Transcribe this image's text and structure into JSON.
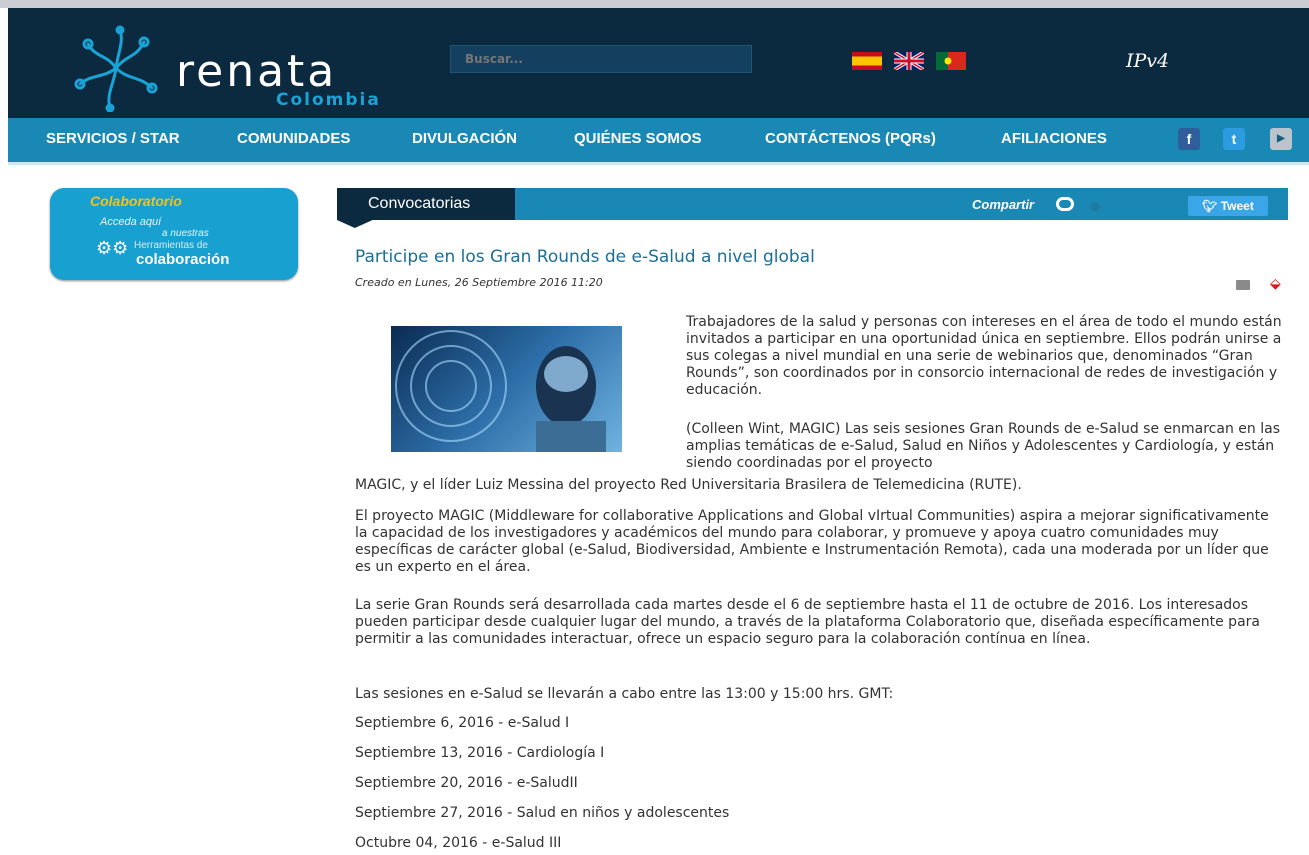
{
  "header": {
    "logo_text": "renata",
    "logo_sub": "Colombia",
    "search_placeholder": "Buscar...",
    "flags": [
      "flag-spain",
      "flag-uk",
      "flag-portugal"
    ],
    "ipv4": "IPv4"
  },
  "nav": {
    "items": [
      "SERVICIOS / STAR",
      "COMUNIDADES",
      "DIVULGACIÓN",
      "QUIÉNES SOMOS",
      "CONTÁCTENOS (PQRs)",
      "AFILIACIONES"
    ],
    "social": [
      "facebook-icon",
      "twitter-icon",
      "youtube-icon"
    ]
  },
  "sidebar": {
    "title": "Colaboratorio",
    "acceda": "Acceda aquí",
    "nuestras": "a nuestras",
    "herramientas": "Herramientas de",
    "colaboracion": "colaboración"
  },
  "section": {
    "title": "Convocatorias",
    "compartir": "Compartir",
    "tweet": "Tweet"
  },
  "article": {
    "title": "Participe en los Gran Rounds de e-Salud a nivel global",
    "date": "Creado en Lunes, 26 Septiembre 2016 11:20",
    "p1": "Trabajadores de la salud y personas con intereses en el área de todo el mundo están invitados a participar en una oportunidad única en septiembre. Ellos podrán unirse a sus colegas a nivel mundial en una serie de webinarios que, denominados “Gran Rounds”, son coordinados por in consorcio internacional de redes de investigación y educación.",
    "p2a": "(Colleen Wint, MAGIC) Las seis sesiones Gran Rounds de e-Salud se enmarcan en las amplias temáticas de e-Salud, Salud en Niños y Adolescentes y Cardiología, y están siendo coordinadas por el proyecto",
    "p2b": "MAGIC, y el líder Luiz Messina del proyecto Red Universitaria Brasilera de Telemedicina (RUTE).",
    "p3": "El proyecto MAGIC (Middleware for collaborative Applications and Global vIrtual Communities) aspira a mejorar significativamente la capacidad de los investigadores y académicos del mundo para colaborar, y promueve y apoya cuatro comunidades muy específicas de carácter global (e-Salud, Biodiversidad, Ambiente e Instrumentación Remota), cada una moderada por un líder que es un experto en el área.",
    "p4": "La serie Gran Rounds será desarrollada cada martes desde el 6 de septiembre hasta el 11 de octubre de 2016. Los interesados pueden participar desde cualquier lugar del mundo, a través de la plataforma Colaboratorio que, diseñada específicamente para permitir a las comunidades interactuar, ofrece un espacio seguro para la colaboración contínua en línea.",
    "p5": "Las sesiones en e-Salud se llevarán a cabo entre las 13:00 y 15:00 hrs. GMT:",
    "sessions": [
      "Septiembre 6, 2016 - e-Salud I",
      "Septiembre 13, 2016 - Cardiología I",
      "Septiembre 20, 2016 - e-SaludII",
      "Septiembre 27, 2016 - Salud en niños y adolescentes",
      "Octubre 04, 2016 - e-Salud III"
    ],
    "icons": [
      "print-icon",
      "pdf-icon"
    ]
  }
}
